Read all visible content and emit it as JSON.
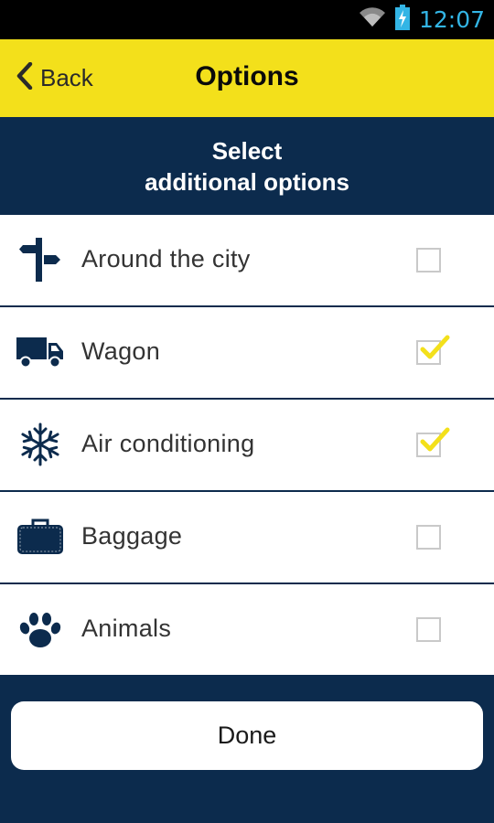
{
  "status_bar": {
    "time": "12:07",
    "icons": [
      "wifi-icon",
      "battery-charging-icon"
    ],
    "time_color": "#33b5e5"
  },
  "app_bar": {
    "back_label": "Back",
    "title": "Options",
    "background": "#f3e01b"
  },
  "subheader": {
    "line1": "Select",
    "line2": "additional options",
    "background": "#0c2b4d"
  },
  "options": [
    {
      "label": "Around the city",
      "icon": "signpost-icon",
      "checked": false
    },
    {
      "label": "Wagon",
      "icon": "truck-icon",
      "checked": true
    },
    {
      "label": "Air conditioning",
      "icon": "snowflake-icon",
      "checked": true
    },
    {
      "label": "Baggage",
      "icon": "suitcase-icon",
      "checked": false
    },
    {
      "label": "Animals",
      "icon": "paw-icon",
      "checked": false
    }
  ],
  "done_button": {
    "label": "Done"
  },
  "colors": {
    "checkmark": "#f3e01b",
    "icon": "#0c2b4d"
  }
}
